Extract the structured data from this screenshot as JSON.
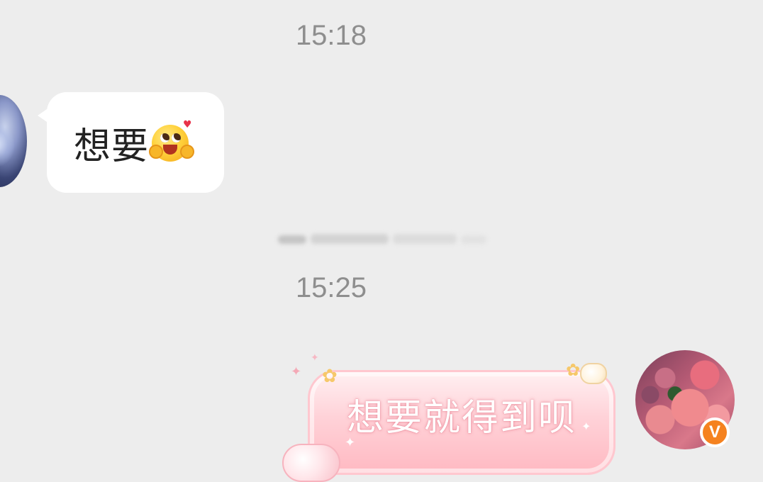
{
  "chat": {
    "messages": [
      {
        "type": "timestamp",
        "text": "15:18"
      },
      {
        "type": "incoming",
        "sender_avatar": "avatar-left",
        "text": "想要",
        "emoji": "hugging-face-emoji"
      },
      {
        "type": "system-notice",
        "text": "",
        "note": "blurred"
      },
      {
        "type": "timestamp",
        "text": "15:25"
      },
      {
        "type": "outgoing",
        "sender_avatar": "avatar-right",
        "text": "想要就得到呗",
        "bubble_style": "pink-decorated"
      }
    ]
  },
  "self": {
    "verified_badge": "V"
  },
  "colors": {
    "background": "#ededed",
    "incoming_bubble": "#ffffff",
    "outgoing_bubble": "#ffc2cb",
    "timestamp": "#8e8e8e",
    "verified_badge": "#f5821f"
  }
}
